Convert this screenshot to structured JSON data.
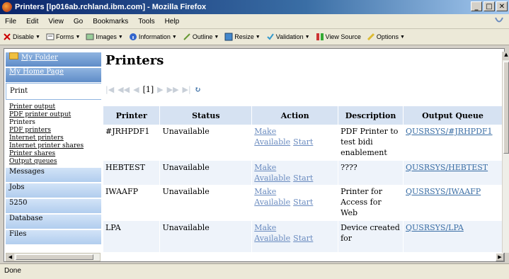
{
  "window": {
    "title": "Printers [lp016ab.rchland.ibm.com] - Mozilla Firefox"
  },
  "menubar": [
    "File",
    "Edit",
    "View",
    "Go",
    "Bookmarks",
    "Tools",
    "Help"
  ],
  "toolbar": [
    "Disable",
    "Forms",
    "Images",
    "Information",
    "Outline",
    "Resize",
    "Validation",
    "View Source",
    "Options"
  ],
  "sidebar": {
    "folder": "My Folder",
    "home": "My Home Page",
    "print": "Print",
    "print_items": [
      "Printer output",
      "PDF printer output",
      "Printers",
      "PDF printers",
      "Internet printers",
      "Internet printer shares",
      "Printer shares",
      "Output queues"
    ],
    "sections": [
      "Messages",
      "Jobs",
      "5250",
      "Database",
      "Files"
    ]
  },
  "page": {
    "title": "Printers",
    "pager": "[1]"
  },
  "table": {
    "headers": [
      "Printer",
      "Status",
      "Action",
      "Description",
      "Output Queue"
    ],
    "rows": [
      {
        "printer": "#JRHPDF1",
        "status": "Unavailable",
        "action1": "Make Available",
        "action2": "Start",
        "description": "PDF Printer to test bidi enablement",
        "queue": "QUSRSYS/#JRHPDF1"
      },
      {
        "printer": "HEBTEST",
        "status": "Unavailable",
        "action1": "Make Available",
        "action2": "Start",
        "description": "????",
        "queue": "QUSRSYS/HEBTEST"
      },
      {
        "printer": "IWAAFP",
        "status": "Unavailable",
        "action1": "Make Available",
        "action2": "Start",
        "description": "Printer for Access for Web",
        "queue": "QUSRSYS/IWAAFP"
      },
      {
        "printer": "LPA",
        "status": "Unavailable",
        "action1": "Make Available",
        "action2": "Start",
        "description": "Device created for",
        "queue": "QUSRSYS/LPA"
      }
    ]
  },
  "status": {
    "text": "Done"
  }
}
